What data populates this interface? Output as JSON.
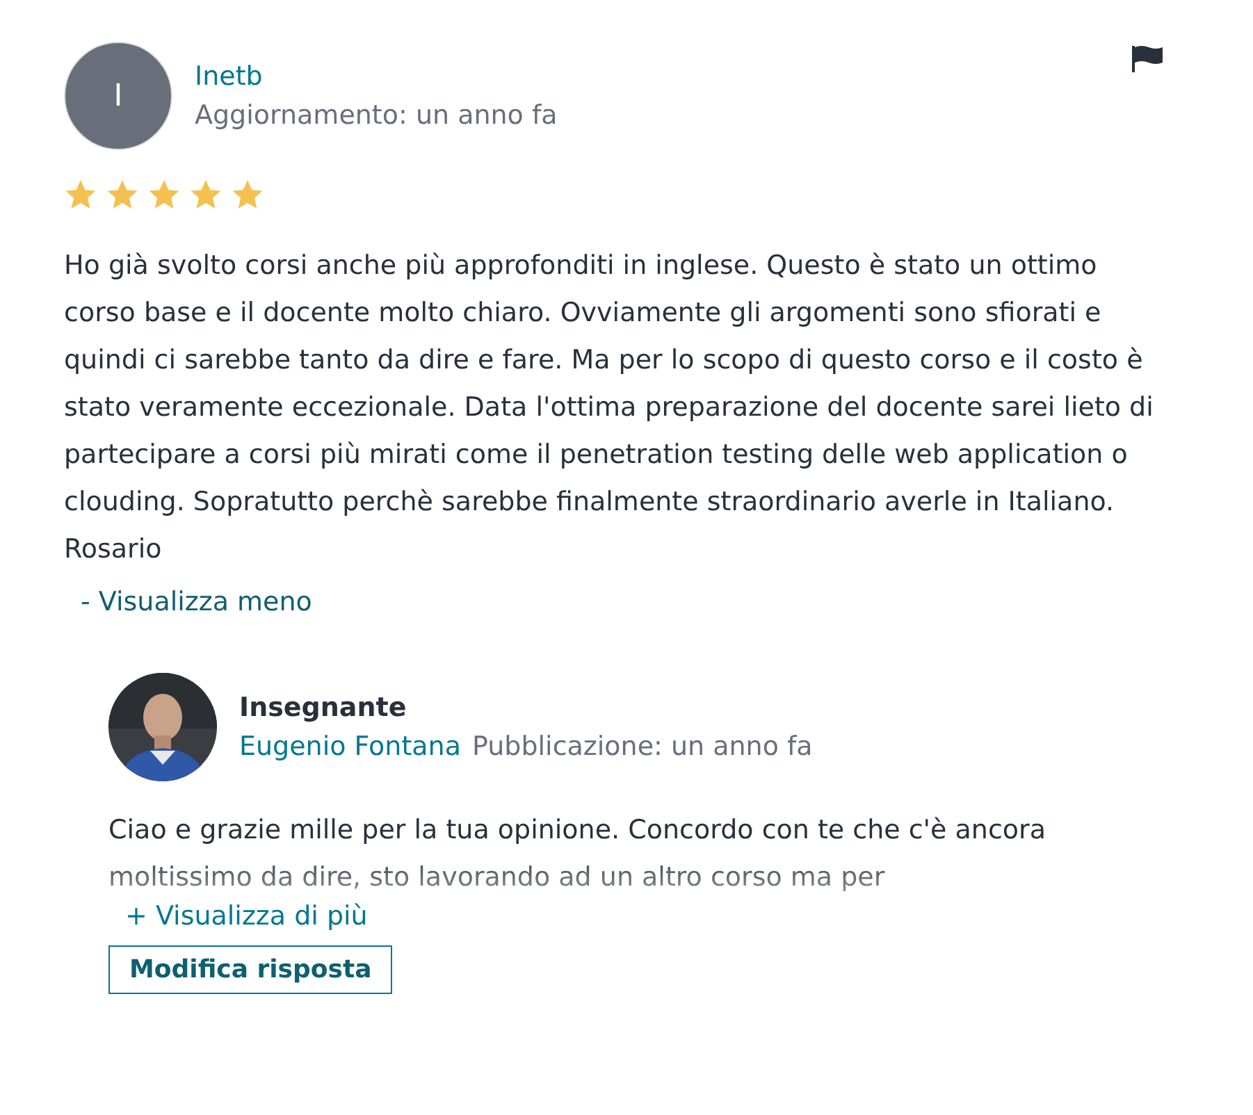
{
  "review": {
    "avatar_initial": "I",
    "author": "Inetb",
    "meta": "Aggiornamento: un anno fa",
    "stars": 5,
    "text": "Ho già svolto corsi anche più approfonditi in inglese. Questo è stato un ottimo corso base e il docente molto chiaro. Ovviamente gli argomenti sono sfiorati e quindi ci sarebbe tanto da dire e fare. Ma per lo scopo di questo corso e il costo è stato veramente eccezionale. Data l'ottima preparazione del docente sarei lieto di partecipare a corsi più mirati come il penetration testing delle web application o clouding. Sopratutto perchè sarebbe finalmente straordinario averle in Italiano.\nRosario",
    "toggle": "- Visualizza meno"
  },
  "response": {
    "role": "Insegnante",
    "author": "Eugenio Fontana",
    "meta": "Pubblicazione: un anno fa",
    "text": "Ciao e grazie mille per la tua opinione. Concordo con te che c'è ancora moltissimo da dire, sto lavorando ad un altro corso ma per",
    "toggle": "+ Visualizza di più",
    "edit_button": "Modifica risposta"
  }
}
